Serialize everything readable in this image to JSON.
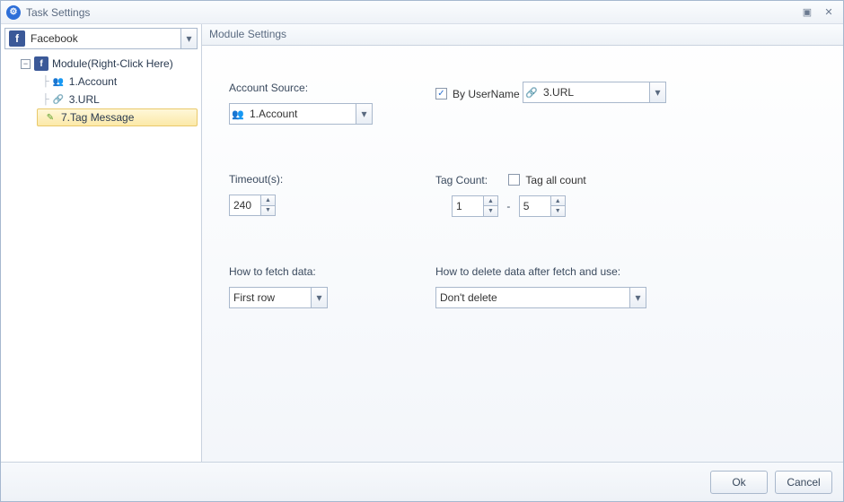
{
  "window": {
    "title": "Task Settings"
  },
  "sidebar": {
    "selector": {
      "label": "Facebook"
    },
    "root": {
      "label": "Module(Right-Click Here)"
    },
    "items": [
      {
        "label": "1.Account"
      },
      {
        "label": "3.URL"
      },
      {
        "label": "7.Tag Message"
      }
    ]
  },
  "main": {
    "header": "Module Settings",
    "account_source": {
      "label": "Account Source:",
      "value": "1.Account"
    },
    "by_username": {
      "label": "By UserName",
      "checked": true,
      "value": "3.URL"
    },
    "timeout": {
      "label": "Timeout(s):",
      "value": "240"
    },
    "tag_count": {
      "label": "Tag Count:",
      "all_label": "Tag all count",
      "all_checked": false,
      "from": "1",
      "to": "5",
      "sep": "-"
    },
    "fetch": {
      "label": "How to fetch data:",
      "value": "First row"
    },
    "delete": {
      "label": "How to delete data after fetch and use:",
      "value": "Don't delete"
    }
  },
  "footer": {
    "ok": "Ok",
    "cancel": "Cancel"
  }
}
